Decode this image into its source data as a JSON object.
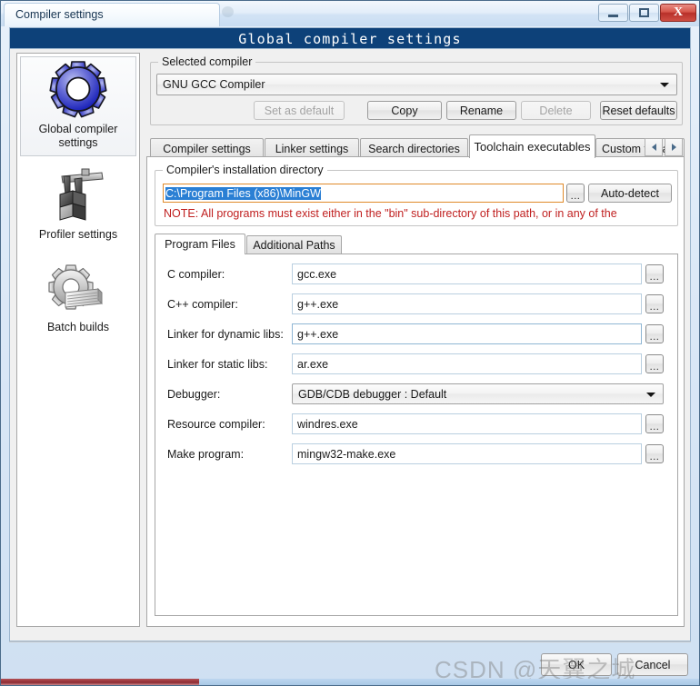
{
  "window": {
    "titlebar_tab": "Compiler settings",
    "minimize_label": "Minimize",
    "maximize_label": "Maximize",
    "close_label": "X"
  },
  "banner": {
    "title": "Global compiler settings"
  },
  "sidebar": {
    "items": [
      {
        "label_line1": "Global compiler",
        "label_line2": "settings",
        "icon": "gear-icon",
        "selected": true
      },
      {
        "label_line1": "Profiler settings",
        "label_line2": "",
        "icon": "caliper-blocks-icon",
        "selected": false
      },
      {
        "label_line1": "Batch builds",
        "label_line2": "",
        "icon": "gear-stack-icon",
        "selected": false
      }
    ]
  },
  "selected_compiler": {
    "group_title": "Selected compiler",
    "combo_value": "GNU GCC Compiler",
    "buttons": [
      {
        "label": "Set as default",
        "disabled": true
      },
      {
        "label": "Copy",
        "disabled": false
      },
      {
        "label": "Rename",
        "disabled": false
      },
      {
        "label": "Delete",
        "disabled": true
      },
      {
        "label": "Reset defaults",
        "disabled": false
      }
    ]
  },
  "tabs": {
    "items": [
      {
        "label": "Compiler settings",
        "active": false
      },
      {
        "label": "Linker settings",
        "active": false
      },
      {
        "label": "Search directories",
        "active": false
      },
      {
        "label": "Toolchain executables",
        "active": true
      },
      {
        "label": "Custom variab",
        "active": false
      }
    ],
    "scroll_left": "◀",
    "scroll_right": "▶"
  },
  "install_dir": {
    "group_title": "Compiler's installation directory",
    "value": "C:\\Program Files (x86)\\MinGW",
    "browse_label": "...",
    "autodetect_label": "Auto-detect",
    "note": "NOTE: All programs must exist either in the \"bin\" sub-directory of this path, or in any of the"
  },
  "inner_tabs": {
    "items": [
      {
        "label": "Program Files",
        "active": true
      },
      {
        "label": "Additional Paths",
        "active": false
      }
    ]
  },
  "program_files": {
    "browse_label": "...",
    "fields": [
      {
        "label": "C compiler:",
        "value": "gcc.exe",
        "type": "text",
        "focused": false
      },
      {
        "label": "C++ compiler:",
        "value": "g++.exe",
        "type": "text",
        "focused": false
      },
      {
        "label": "Linker for dynamic libs:",
        "value": "g++.exe",
        "type": "text",
        "focused": true
      },
      {
        "label": "Linker for static libs:",
        "value": "ar.exe",
        "type": "text",
        "focused": false
      },
      {
        "label": "Debugger:",
        "value": "GDB/CDB debugger : Default",
        "type": "combo",
        "focused": false
      },
      {
        "label": "Resource compiler:",
        "value": "windres.exe",
        "type": "text",
        "focused": false
      },
      {
        "label": "Make program:",
        "value": "mingw32-make.exe",
        "type": "text",
        "focused": false
      }
    ]
  },
  "footer": {
    "ok_label": "OK",
    "cancel_label": "Cancel"
  },
  "watermark": {
    "text": "CSDN @天翼之城"
  },
  "colors": {
    "banner_blue": "#0d4179",
    "note_red": "#c02020",
    "selection_blue": "#2a7fd4",
    "close_red": "#b8302a"
  }
}
